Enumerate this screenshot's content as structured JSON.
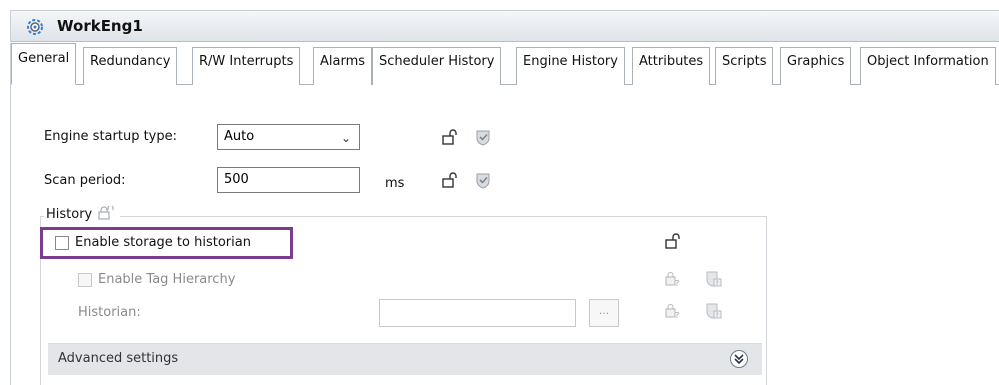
{
  "window": {
    "title": "WorkEng1"
  },
  "tabs": [
    {
      "label": "General"
    },
    {
      "label": "Redundancy"
    },
    {
      "label": "R/W Interrupts"
    },
    {
      "label": "Alarms"
    },
    {
      "label": "Scheduler History"
    },
    {
      "label": "Engine History"
    },
    {
      "label": "Attributes"
    },
    {
      "label": "Scripts"
    },
    {
      "label": "Graphics"
    },
    {
      "label": "Object Information"
    }
  ],
  "general": {
    "startup_type_label": "Engine startup type:",
    "startup_type_value": "Auto",
    "scan_period_label": "Scan period:",
    "scan_period_value": "500",
    "scan_period_unit": "ms"
  },
  "history": {
    "title": "History",
    "enable_storage_label": "Enable storage to historian",
    "enable_tag_hierarchy_label": "Enable Tag Hierarchy",
    "historian_label": "Historian:",
    "historian_value": "",
    "browse_label": "...",
    "advanced_settings_label": "Advanced settings"
  },
  "icons": {
    "title": "settings-gear-icon",
    "lock": "unlocked-padlock-icon",
    "shield": "shield-check-icon"
  },
  "colors": {
    "highlight_border": "#7b3c8e",
    "active_gear": "#2f7fd6"
  }
}
